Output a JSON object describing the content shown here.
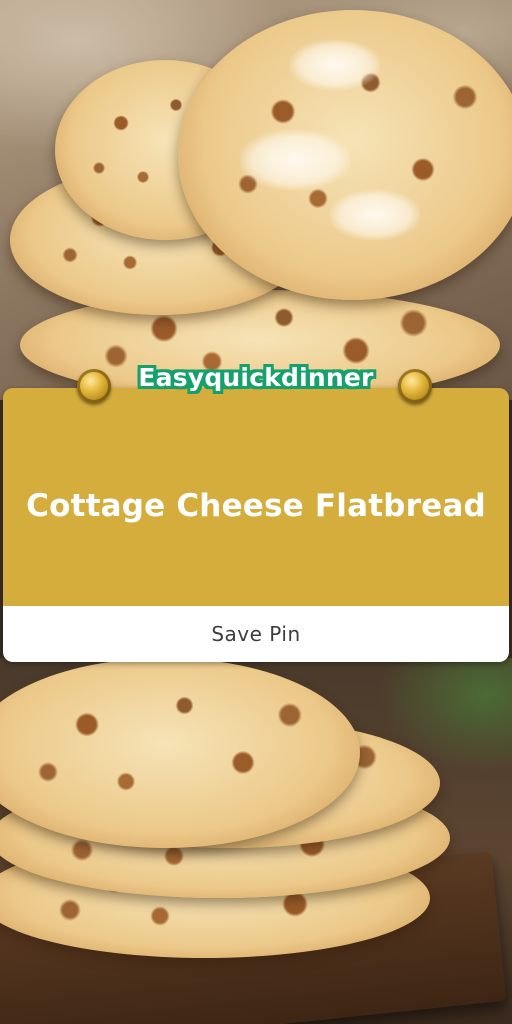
{
  "brand": {
    "name": "Easyquickdinner",
    "color": "#16a06b"
  },
  "card": {
    "title": "Cottage Cheese Flatbread",
    "accent_color": "#d4ad3d",
    "save_label": "Save Pin"
  },
  "images": {
    "top": "stacked-flatbreads-photo",
    "bottom": "flatbreads-on-board-photo"
  }
}
